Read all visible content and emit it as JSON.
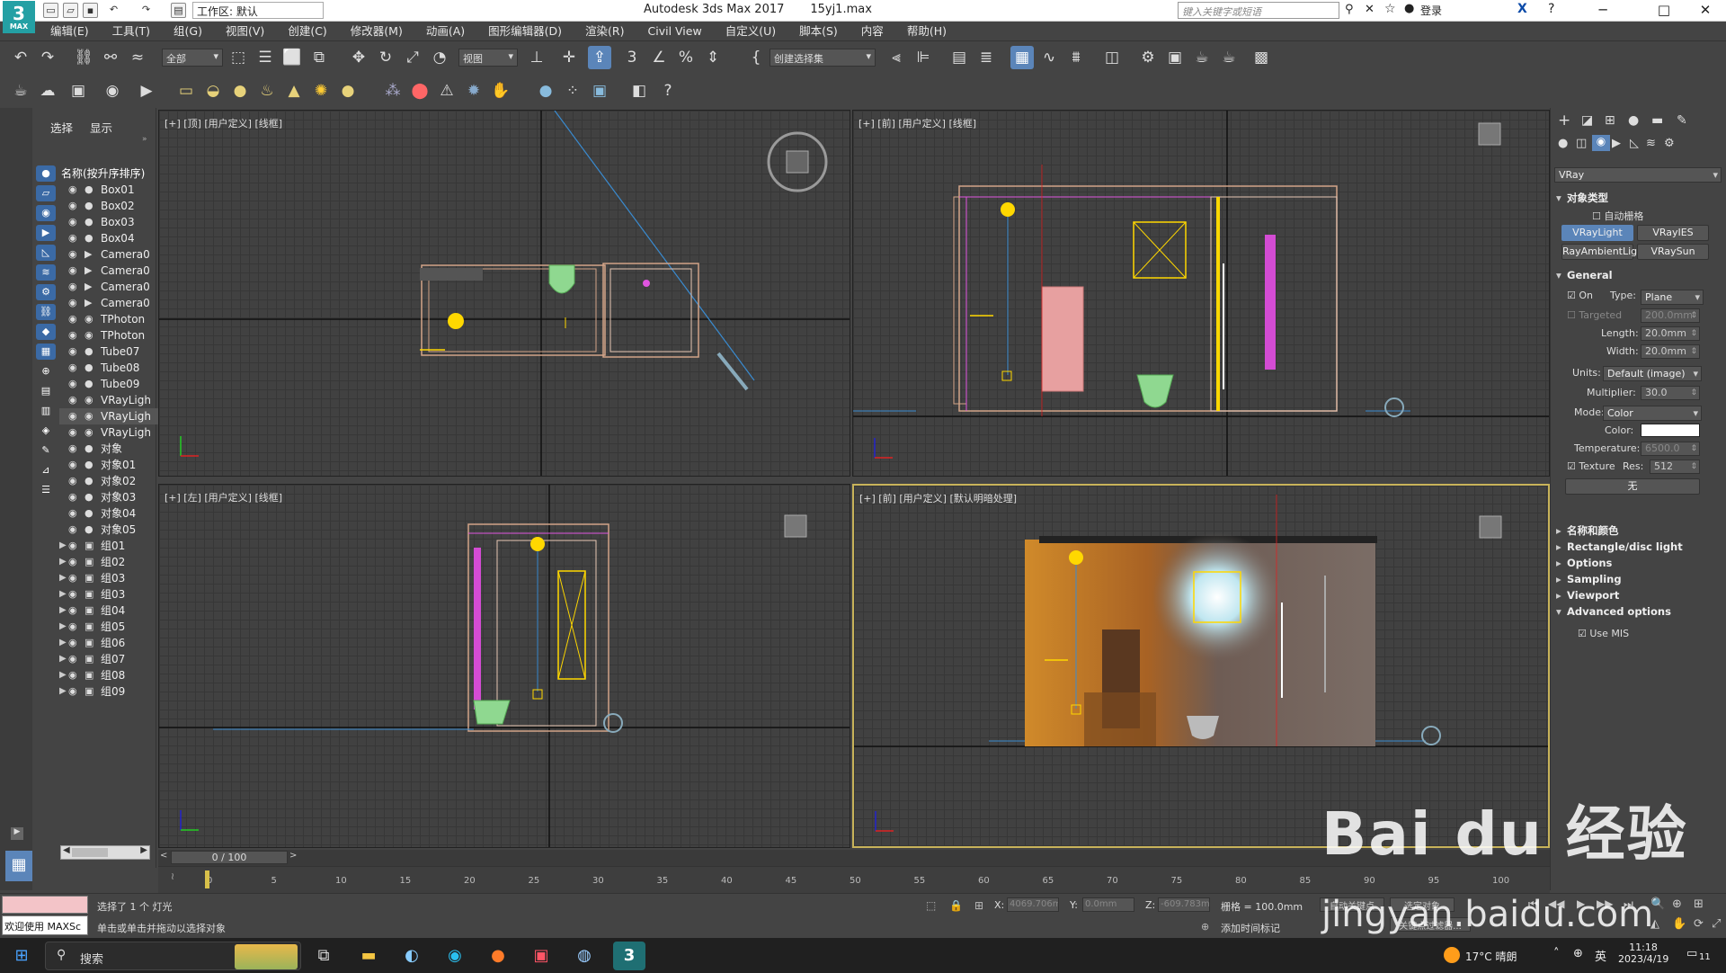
{
  "app": {
    "title": "Autodesk 3ds Max 2017",
    "filename": "15yj1.max",
    "workspace": "工作区: 默认",
    "search_placeholder": "键入关键字或短语",
    "login": "登录",
    "logo": "3",
    "logo_sub": "MAX"
  },
  "menu": [
    "编辑(E)",
    "工具(T)",
    "组(G)",
    "视图(V)",
    "创建(C)",
    "修改器(M)",
    "动画(A)",
    "图形编辑器(D)",
    "渲染(R)",
    "Civil View",
    "自定义(U)",
    "脚本(S)",
    "内容",
    "帮助(H)"
  ],
  "toolbar": {
    "filter": "全部",
    "ref_coord": "视图",
    "selset": "创建选择集"
  },
  "scene_explorer": {
    "tabs": [
      "选择",
      "显示"
    ],
    "column_header": "名称(按升序排序)",
    "objects": [
      {
        "name": "Box01",
        "type": "geom"
      },
      {
        "name": "Box02",
        "type": "geom"
      },
      {
        "name": "Box03",
        "type": "geom"
      },
      {
        "name": "Box04",
        "type": "geom"
      },
      {
        "name": "Camera0",
        "type": "camera"
      },
      {
        "name": "Camera0",
        "type": "camera"
      },
      {
        "name": "Camera0",
        "type": "camera"
      },
      {
        "name": "Camera0",
        "type": "camera"
      },
      {
        "name": "TPhoton",
        "type": "light"
      },
      {
        "name": "TPhoton",
        "type": "light"
      },
      {
        "name": "Tube07",
        "type": "geom"
      },
      {
        "name": "Tube08",
        "type": "geom"
      },
      {
        "name": "Tube09",
        "type": "geom"
      },
      {
        "name": "VRayLigh",
        "type": "light"
      },
      {
        "name": "VRayLigh",
        "type": "light"
      },
      {
        "name": "VRayLigh",
        "type": "light"
      },
      {
        "name": "对象",
        "type": "geom"
      },
      {
        "name": "对象01",
        "type": "geom"
      },
      {
        "name": "对象02",
        "type": "geom"
      },
      {
        "name": "对象03",
        "type": "geom"
      },
      {
        "name": "对象04",
        "type": "geom"
      },
      {
        "name": "对象05",
        "type": "geom"
      },
      {
        "name": "组01",
        "type": "group"
      },
      {
        "name": "组02",
        "type": "group"
      },
      {
        "name": "组03",
        "type": "group"
      },
      {
        "name": "组03",
        "type": "group"
      },
      {
        "name": "组04",
        "type": "group"
      },
      {
        "name": "组05",
        "type": "group"
      },
      {
        "name": "组06",
        "type": "group"
      },
      {
        "name": "组07",
        "type": "group"
      },
      {
        "name": "组08",
        "type": "group"
      },
      {
        "name": "组09",
        "type": "group"
      }
    ]
  },
  "viewports": [
    {
      "label": "[+] [顶] [用户定义] [线框]"
    },
    {
      "label": "[+] [前] [用户定义] [线框]"
    },
    {
      "label": "[+] [左] [用户定义] [线框]"
    },
    {
      "label": "[+] [前] [用户定义] [默认明暗处理]"
    }
  ],
  "command_panel": {
    "renderer": "VRay",
    "object_type": {
      "title": "对象类型",
      "autogrid": "自动栅格",
      "buttons": [
        "VRayLight",
        "VRayIES",
        "RayAmbientLigh",
        "VRaySun"
      ]
    },
    "general": {
      "title": "General",
      "on": "On",
      "type_label": "Type:",
      "type_value": "Plane",
      "targeted": "Targeted",
      "targeted_value": "200.0mm",
      "length_label": "Length:",
      "length": "20.0mm",
      "width_label": "Width:",
      "width": "20.0mm",
      "units_label": "Units:",
      "units": "Default (image)",
      "multiplier_label": "Multiplier:",
      "multiplier": "30.0",
      "mode_label": "Mode:",
      "mode": "Color",
      "color_label": "Color:",
      "color": "#ffffff",
      "temperature_label": "Temperature:",
      "temperature": "6500.0",
      "texture": "Texture",
      "res_label": "Res:",
      "res": "512",
      "none_btn": "无"
    },
    "rollouts": [
      "名称和颜色",
      "Rectangle/disc light",
      "Options",
      "Sampling",
      "Viewport",
      "Advanced options"
    ],
    "use_mis": "Use MIS"
  },
  "timeline": {
    "frame": "0 / 100",
    "ticks": [
      "0",
      "5",
      "10",
      "15",
      "20",
      "25",
      "30",
      "35",
      "40",
      "45",
      "50",
      "55",
      "60",
      "65",
      "70",
      "75",
      "80",
      "85",
      "90",
      "95",
      "100"
    ]
  },
  "status": {
    "maxscript": "欢迎使用 MAXSc",
    "selected": "选择了 1 个 灯光",
    "prompt": "单击或单击并拖动以选择对象",
    "x_label": "X:",
    "x": "4069.706m",
    "y_label": "Y:",
    "y": "0.0mm",
    "z_label": "Z:",
    "z": "-609.783m",
    "grid": "栅格 = 100.0mm",
    "add_time_tag": "添加时间标记",
    "auto_key": "自动关键点",
    "set_key": "选定对象",
    "key_filter": "关键点过滤器..."
  },
  "taskbar": {
    "search": "搜索",
    "weather": "17°C 晴朗",
    "ime": "英",
    "time": "11:18",
    "date": "2023/4/19",
    "badge": "11"
  },
  "watermark": {
    "brand": "Bai du 经验",
    "url": "jingyan.baidu.com"
  }
}
